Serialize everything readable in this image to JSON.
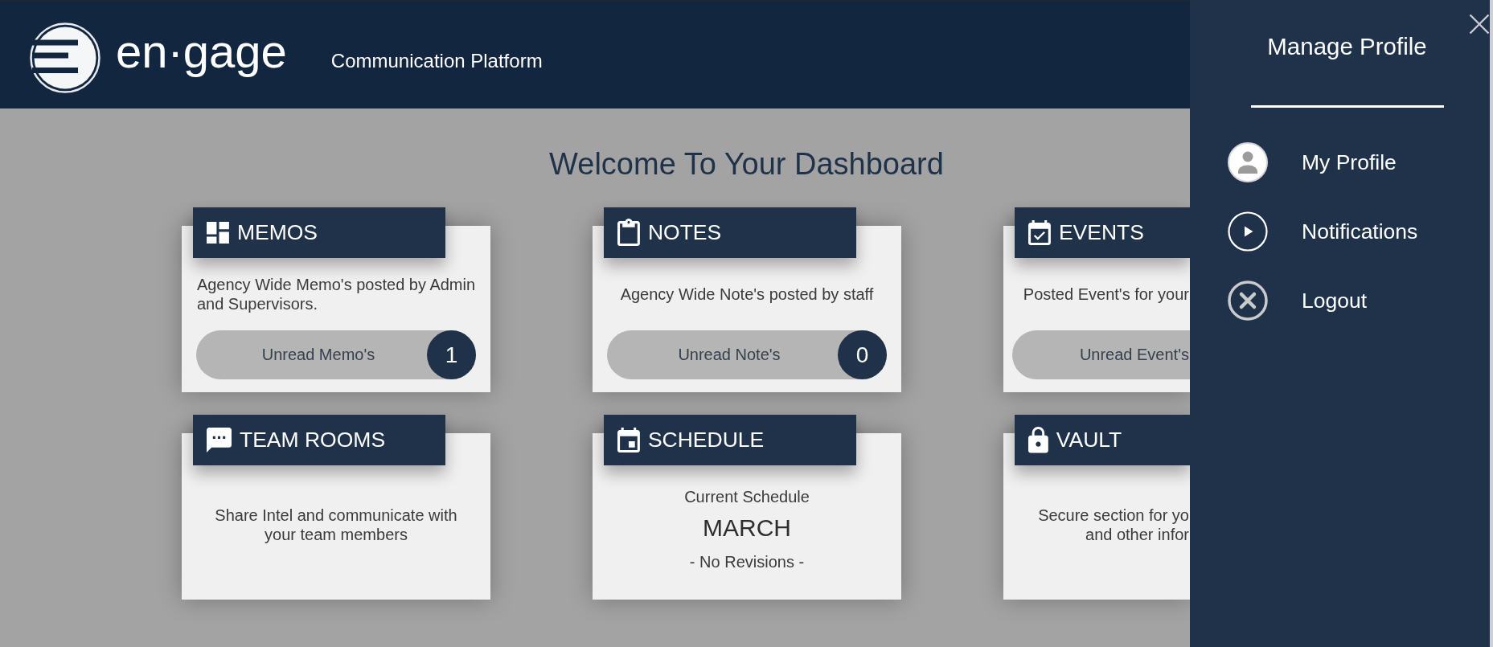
{
  "header": {
    "logo_text": "en·gage",
    "subtitle": "Communication Platform"
  },
  "dashboard": {
    "title": "Welcome To Your Dashboard",
    "cards": [
      {
        "kind": "counter",
        "title": "MEMOS",
        "description": "Agency Wide Memo's posted by Admin\nand Supervisors.",
        "counter": {
          "label": "Unread Memo's",
          "count": "1"
        }
      },
      {
        "kind": "counter",
        "title": "NOTES",
        "description": "Agency Wide Note's posted by staff",
        "counter": {
          "label": "Unread Note's",
          "count": "0"
        }
      },
      {
        "kind": "counter",
        "title": "EVENTS",
        "description": "Posted Event's for your",
        "counter": {
          "label": "Unread Event's"
        }
      },
      {
        "kind": "info",
        "title": "TEAM ROOMS",
        "description": "Share Intel and communicate with\nyour team members"
      },
      {
        "kind": "schedule",
        "title": "SCHEDULE",
        "label": "Current Schedule",
        "month": "MARCH",
        "note": "- No Revisions -"
      },
      {
        "kind": "info",
        "title": "VAULT",
        "description": "Secure section for yo\nand other infor"
      }
    ]
  },
  "profile_panel": {
    "title": "Manage Profile",
    "items": [
      {
        "label": "My Profile"
      },
      {
        "label": "Notifications"
      },
      {
        "label": "Logout"
      }
    ]
  }
}
